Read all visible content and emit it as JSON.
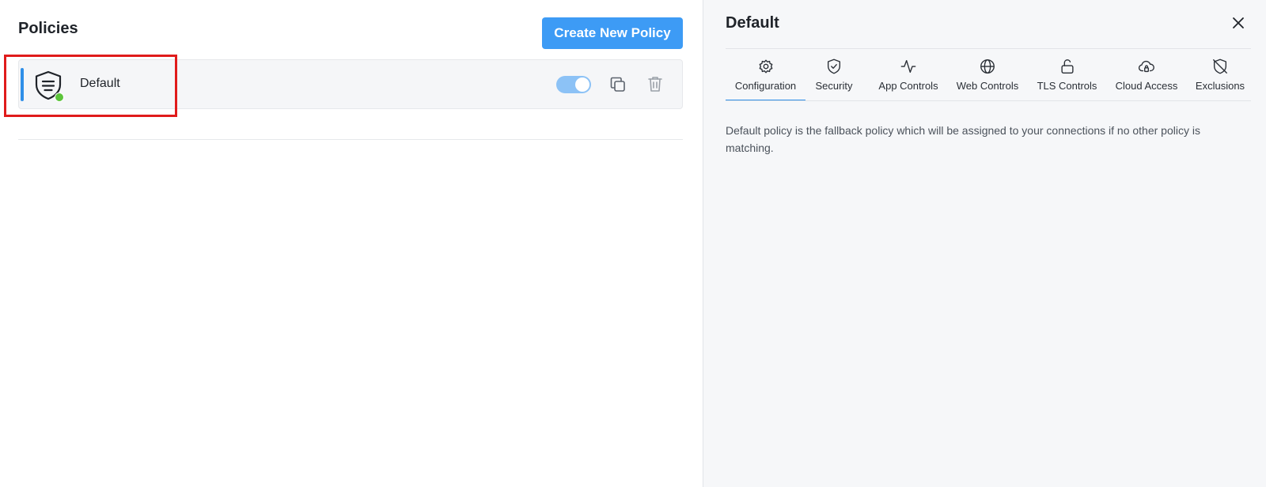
{
  "policies": {
    "title": "Policies",
    "create_button": "Create New Policy",
    "items": [
      {
        "name": "Default",
        "enabled": true,
        "status": "active",
        "icon": "shield-policy-icon"
      }
    ]
  },
  "panel": {
    "title": "Default",
    "tabs": [
      {
        "label": "Configuration",
        "icon": "gear-icon",
        "active": true
      },
      {
        "label": "Security",
        "icon": "shield-check-icon",
        "active": false
      },
      {
        "label": "App Controls",
        "icon": "activity-icon",
        "active": false
      },
      {
        "label": "Web Controls",
        "icon": "globe-icon",
        "active": false
      },
      {
        "label": "TLS Controls",
        "icon": "unlock-icon",
        "active": false
      },
      {
        "label": "Cloud Access",
        "icon": "cloud-lock-icon",
        "active": false
      },
      {
        "label": "Exclusions",
        "icon": "shield-off-icon",
        "active": false
      }
    ],
    "description": "Default policy is the fallback policy which will be assigned to your connections if no other policy is matching."
  },
  "colors": {
    "accent": "#3d9bf5",
    "status_active": "#5cc43b",
    "annotation": "#e01b1b"
  }
}
